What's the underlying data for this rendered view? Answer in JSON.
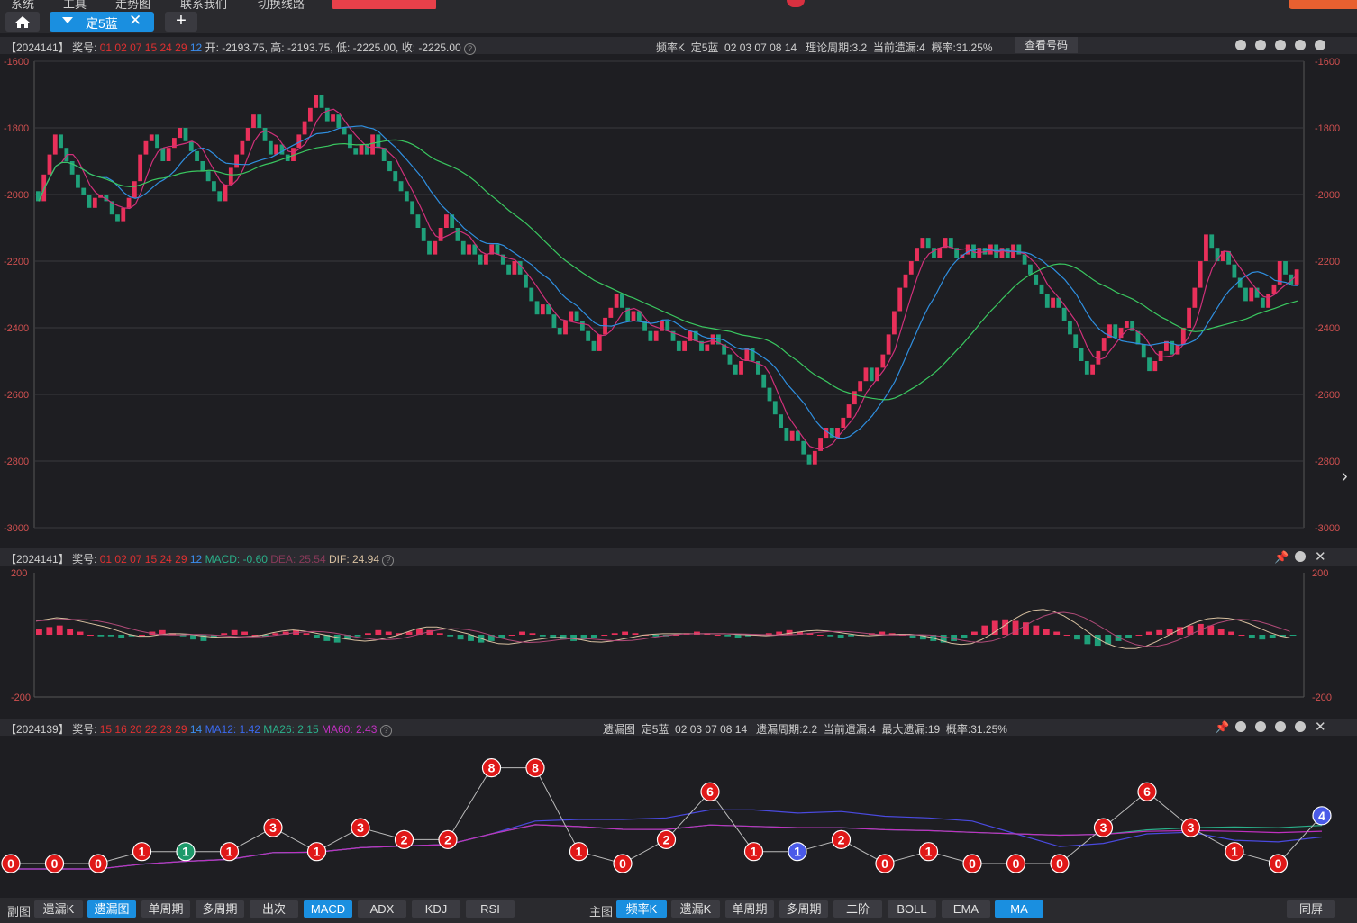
{
  "menu": [
    "系统",
    "工具",
    "走势图",
    "联系我们",
    "切换线路"
  ],
  "tabs": {
    "active": "定5蓝"
  },
  "main_header": {
    "issue": "【2024141】",
    "prize_label": "奖号:",
    "red_numbers": "01 02 07 15 24 29",
    "blue_number": "12",
    "ohlc": "开: -2193.75, 高: -2193.75, 低: -2225.00, 收: -2225.00",
    "mode": "频率K",
    "target": "定5蓝",
    "target_numbers": "02 03 07 08 14",
    "theory_cycle": "理论周期:3.2",
    "current_miss": "当前遗漏:4",
    "probability": "概率:31.25%",
    "view_button": "查看号码"
  },
  "macd_header": {
    "issue": "【2024141】",
    "prize_label": "奖号:",
    "red_numbers": "01 02 07 15 24 29",
    "blue_number": "12",
    "macd": "MACD: -0.60",
    "dea": "DEA: 25.54",
    "dif": "DIF: 24.94"
  },
  "miss_header": {
    "issue": "【2024139】",
    "prize_label": "奖号:",
    "red_numbers": "15 16 20 22 23 29",
    "blue_number": "14",
    "ma12": "MA12: 1.42",
    "ma26": "MA26: 2.15",
    "ma60": "MA60: 2.43",
    "mode": "遗漏图",
    "target": "定5蓝",
    "target_numbers": "02 03 07 08 14",
    "miss_cycle": "遗漏周期:2.2",
    "current_miss": "当前遗漏:4",
    "max_miss": "最大遗漏:19",
    "probability": "概率:31.25%"
  },
  "colors": {
    "up": "#e8305a",
    "down": "#1fa07a",
    "ma_fast": "#d0307a",
    "ma_mid": "#2f8fe0",
    "ma_slow": "#3ac860",
    "accent": "#1a8fe0"
  },
  "chart_data": [
    {
      "type": "candlestick",
      "y_ticks": [
        "-1600",
        "-1800",
        "-2000",
        "-2200",
        "-2400",
        "-2600",
        "-2800",
        "-3000"
      ],
      "ylim": [
        -3000,
        -1600
      ],
      "series": [
        {
          "name": "close",
          "values": [
            -2020,
            -1940,
            -1880,
            -1820,
            -1860,
            -1900,
            -1940,
            -1980,
            -2000,
            -2040,
            -2010,
            -2000,
            -2020,
            -2060,
            -2080,
            -2040,
            -2010,
            -1960,
            -1880,
            -1840,
            -1820,
            -1860,
            -1900,
            -1860,
            -1830,
            -1800,
            -1840,
            -1870,
            -1900,
            -1930,
            -1960,
            -1990,
            -2020,
            -1970,
            -1920,
            -1880,
            -1840,
            -1800,
            -1760,
            -1800,
            -1840,
            -1880,
            -1850,
            -1880,
            -1900,
            -1860,
            -1820,
            -1780,
            -1740,
            -1700,
            -1740,
            -1780,
            -1760,
            -1800,
            -1820,
            -1860,
            -1880,
            -1850,
            -1880,
            -1820,
            -1860,
            -1900,
            -1930,
            -1960,
            -1990,
            -2020,
            -2060,
            -2100,
            -2140,
            -2180,
            -2140,
            -2100,
            -2060,
            -2100,
            -2140,
            -2180,
            -2150,
            -2180,
            -2210,
            -2180,
            -2150,
            -2180,
            -2210,
            -2240,
            -2200,
            -2240,
            -2280,
            -2320,
            -2360,
            -2330,
            -2360,
            -2400,
            -2420,
            -2380,
            -2350,
            -2380,
            -2410,
            -2440,
            -2470,
            -2420,
            -2370,
            -2340,
            -2300,
            -2340,
            -2380,
            -2350,
            -2380,
            -2410,
            -2440,
            -2410,
            -2380,
            -2410,
            -2440,
            -2470,
            -2440,
            -2410,
            -2440,
            -2470,
            -2450,
            -2420,
            -2450,
            -2480,
            -2510,
            -2540,
            -2500,
            -2460,
            -2500,
            -2540,
            -2580,
            -2620,
            -2660,
            -2700,
            -2740,
            -2710,
            -2740,
            -2780,
            -2810,
            -2770,
            -2730,
            -2700,
            -2730,
            -2700,
            -2670,
            -2630,
            -2590,
            -2560,
            -2520,
            -2560,
            -2520,
            -2480,
            -2420,
            -2350,
            -2280,
            -2240,
            -2200,
            -2160,
            -2130,
            -2160,
            -2190,
            -2160,
            -2130,
            -2160,
            -2190,
            -2180,
            -2150,
            -2190,
            -2160,
            -2180,
            -2150,
            -2190,
            -2160,
            -2190,
            -2150,
            -2180,
            -2210,
            -2240,
            -2270,
            -2300,
            -2340,
            -2310,
            -2340,
            -2380,
            -2420,
            -2460,
            -2500,
            -2540,
            -2510,
            -2470,
            -2430,
            -2390,
            -2430,
            -2400,
            -2380,
            -2410,
            -2450,
            -2490,
            -2530,
            -2500,
            -2470,
            -2440,
            -2480,
            -2450,
            -2400,
            -2340,
            -2280,
            -2200,
            -2120,
            -2160,
            -2200,
            -2170,
            -2210,
            -2250,
            -2280,
            -2320,
            -2280,
            -2310,
            -2340,
            -2300,
            -2270,
            -2200,
            -2240,
            -2270,
            -2225
          ]
        }
      ]
    },
    {
      "type": "macd",
      "y_ticks": [
        "200",
        "-200"
      ],
      "ylim": [
        -200,
        200
      ],
      "series": [
        {
          "name": "MACD",
          "values": [
            20,
            25,
            30,
            20,
            10,
            0,
            -5,
            -5,
            -10,
            -5,
            0,
            10,
            15,
            5,
            -5,
            -15,
            -20,
            -10,
            5,
            15,
            10,
            0,
            -5,
            5,
            10,
            15,
            5,
            -10,
            -20,
            -25,
            -15,
            -5,
            5,
            15,
            10,
            5,
            10,
            20,
            15,
            5,
            -5,
            -15,
            -20,
            -25,
            -20,
            -10,
            0,
            10,
            5,
            -5,
            -10,
            -15,
            -20,
            -15,
            -10,
            0,
            5,
            10,
            5,
            0,
            -5,
            -5,
            0,
            5,
            10,
            5,
            0,
            -5,
            -10,
            -5,
            0,
            5,
            10,
            15,
            10,
            5,
            0,
            -5,
            -10,
            -5,
            0,
            5,
            10,
            5,
            0,
            -10,
            -15,
            -20,
            -25,
            -20,
            -10,
            10,
            30,
            45,
            50,
            45,
            40,
            30,
            20,
            10,
            0,
            -15,
            -30,
            -35,
            -30,
            -20,
            -10,
            0,
            10,
            15,
            20,
            25,
            30,
            35,
            30,
            20,
            10,
            0,
            -10,
            -15,
            -10,
            -5,
            -1
          ]
        }
      ]
    }
  ],
  "miss_points": [
    0,
    0,
    0,
    1,
    1,
    1,
    3,
    1,
    3,
    2,
    2,
    8,
    8,
    1,
    0,
    2,
    6,
    1,
    1,
    2,
    0,
    1,
    0,
    0,
    0,
    3,
    6,
    3,
    1,
    0,
    4
  ],
  "bottom_left": {
    "label": "副图",
    "buttons": [
      "遗漏K",
      "遗漏图",
      "单周期",
      "多周期",
      "出次",
      "MACD",
      "ADX",
      "KDJ",
      "RSI"
    ]
  },
  "bottom_right": {
    "label": "主图",
    "buttons": [
      "频率K",
      "遗漏K",
      "单周期",
      "多周期",
      "二阶",
      "BOLL",
      "EMA",
      "MA"
    ],
    "sync": "同屏"
  }
}
